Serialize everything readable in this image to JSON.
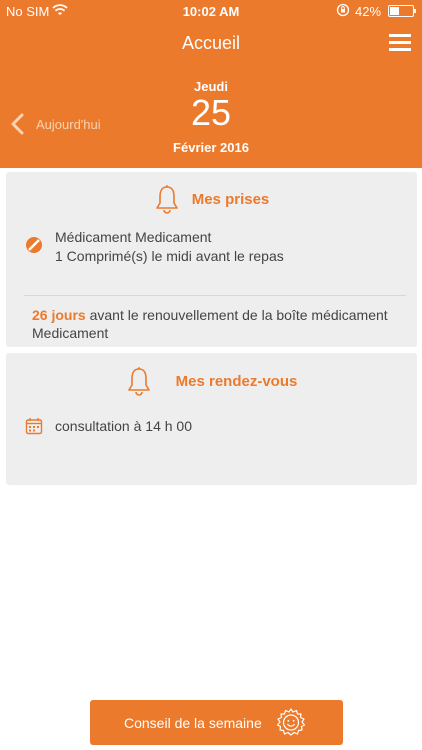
{
  "status_bar": {
    "carrier": "No SIM",
    "time": "10:02 AM",
    "battery": "42%",
    "battery_level": 0.42
  },
  "header": {
    "title": "Accueil",
    "today_label": "Aujourd'hui",
    "weekday": "Jeudi",
    "day": "25",
    "month_year": "Février 2016"
  },
  "prises": {
    "title": "Mes prises",
    "medication_name": "Médicament Medicament",
    "dosage": "1 Comprimé(s) le midi avant le repas",
    "renewal_days": "26 jours",
    "renewal_text": "avant le renouvellement de la boîte médicament Medicament"
  },
  "rendezvous": {
    "title": "Mes rendez-vous",
    "appointment": "consultation à 14 h 00"
  },
  "footer": {
    "tip_button": "Conseil de la semaine"
  },
  "colors": {
    "accent": "#ec7a2c",
    "card": "#eeeeee",
    "text": "#444444"
  },
  "icons": [
    "wifi-icon",
    "rotation-lock-icon",
    "battery-icon",
    "menu-icon",
    "chevron-left-icon",
    "bell-icon",
    "pill-icon",
    "calendar-icon",
    "sun-smiley-icon"
  ]
}
